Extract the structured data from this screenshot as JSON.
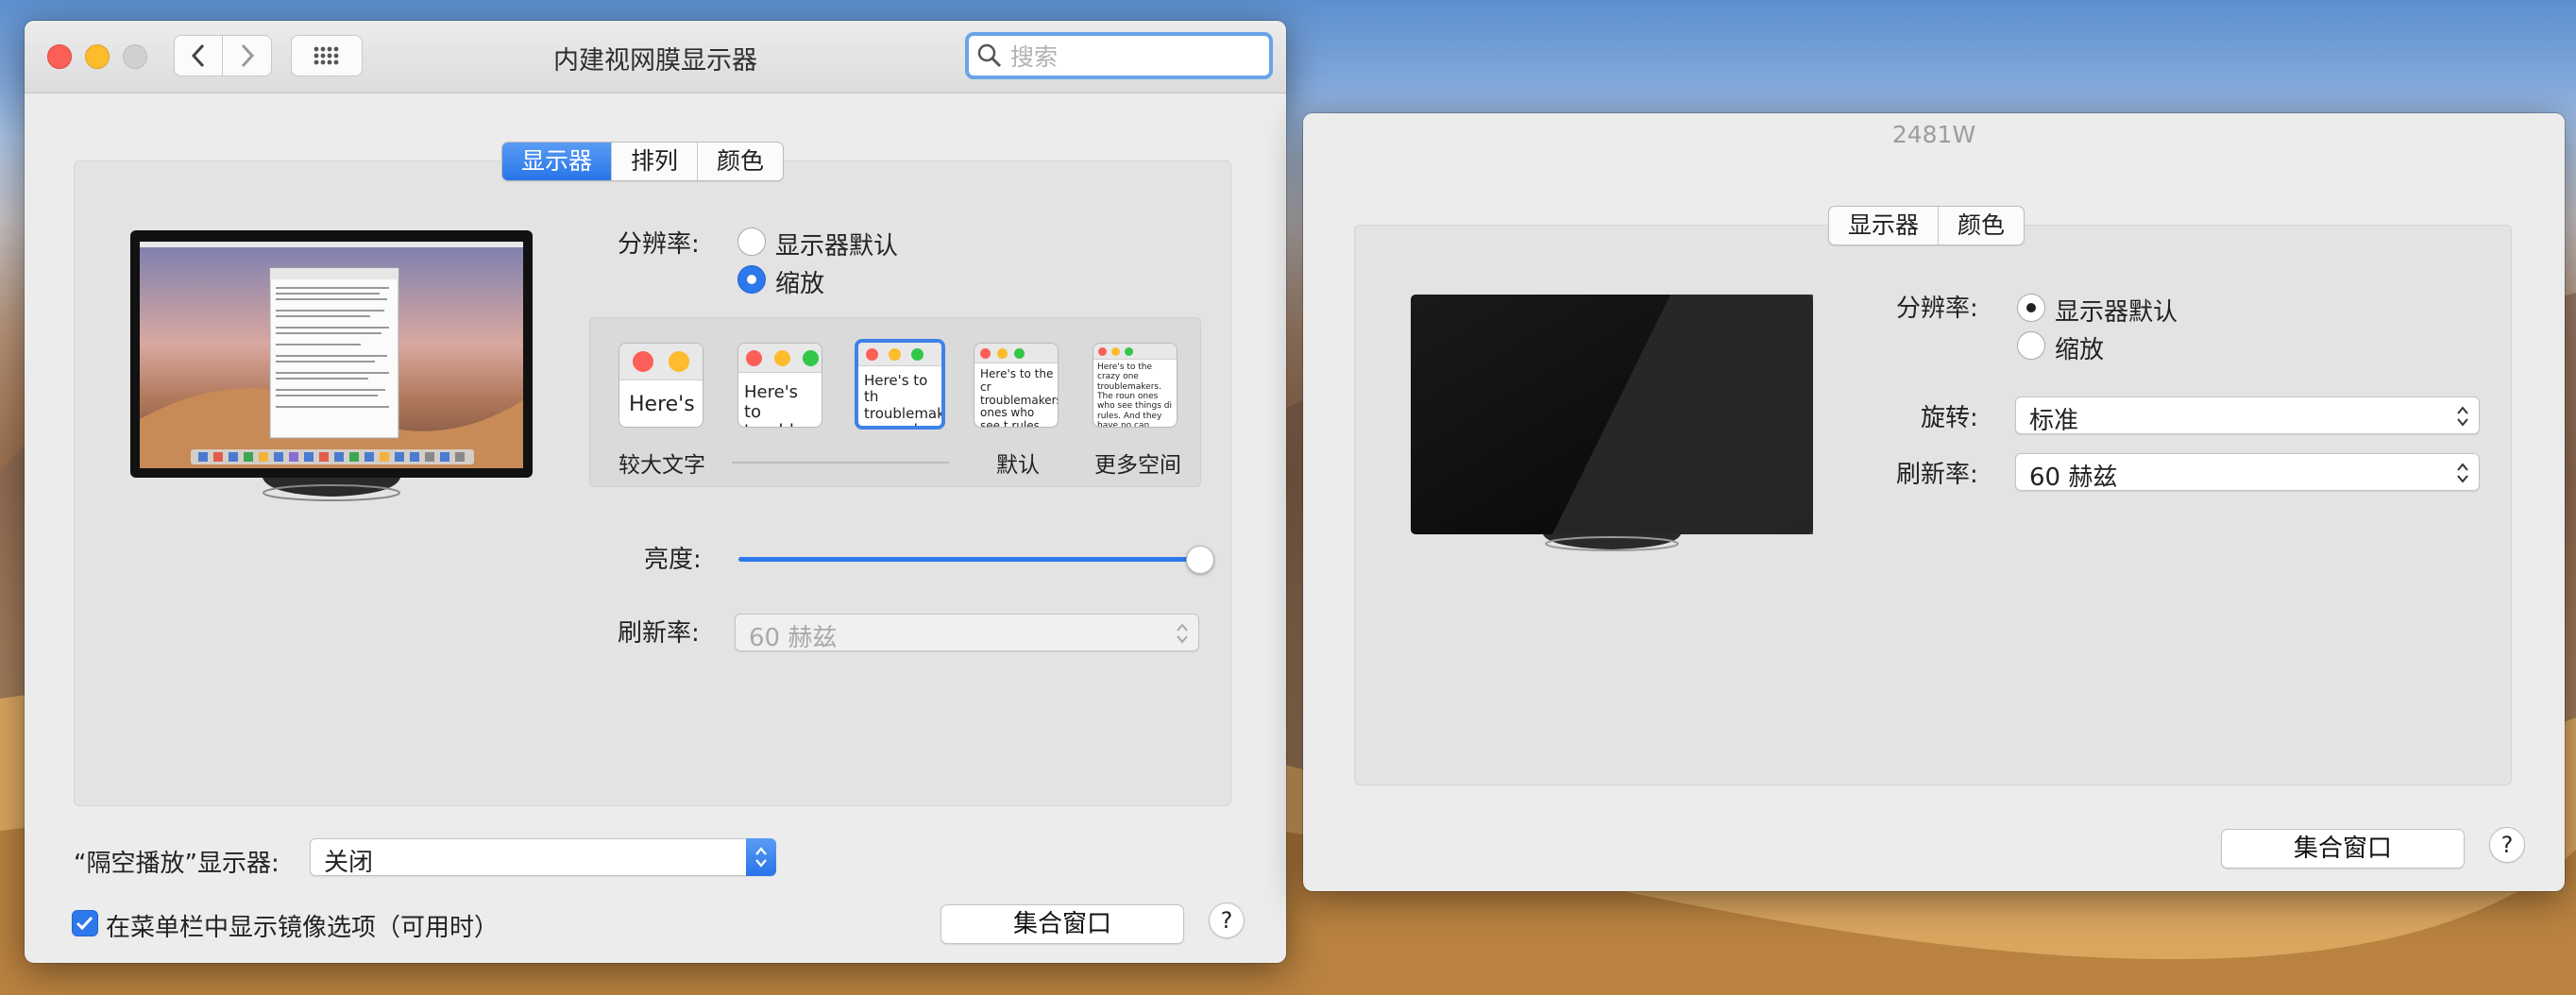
{
  "window1": {
    "title": "内建视网膜显示器",
    "search_placeholder": "搜索",
    "tabs": [
      {
        "label": "显示器",
        "selected": true
      },
      {
        "label": "排列",
        "selected": false
      },
      {
        "label": "颜色",
        "selected": false
      }
    ],
    "resolution": {
      "label": "分辨率:",
      "options": [
        {
          "label": "显示器默认",
          "selected": false
        },
        {
          "label": "缩放",
          "selected": true
        }
      ]
    },
    "scale_options": [
      {
        "sample": "Here's",
        "caption": "较大文字",
        "selected": false
      },
      {
        "sample": "Here's to troublem",
        "caption": "",
        "selected": false
      },
      {
        "sample": "Here's to th troublemak ones who",
        "caption": "",
        "selected": true
      },
      {
        "sample": "Here's to the cr troublemakers. ones who see t rules. And they",
        "caption": "默认",
        "selected": false
      },
      {
        "sample": "Here's to the crazy one troublemakers. The roun ones who see things di rules. And they have no can quote them, disagre them. About the only th Because they change th",
        "caption": "更多空间",
        "selected": false
      }
    ],
    "brightness": {
      "label": "亮度:",
      "value": 1.0
    },
    "refresh_rate": {
      "label": "刷新率:",
      "value": "60 赫兹"
    },
    "airplay": {
      "label": "“隔空播放”显示器:",
      "value": "关闭"
    },
    "mirroring_checkbox": {
      "label": "在菜单栏中显示镜像选项（可用时）",
      "checked": true
    },
    "gather_button": "集合窗口",
    "help": "?"
  },
  "window2": {
    "title": "2481W",
    "tabs": [
      {
        "label": "显示器",
        "selected": true
      },
      {
        "label": "颜色",
        "selected": false
      }
    ],
    "resolution": {
      "label": "分辨率:",
      "options": [
        {
          "label": "显示器默认",
          "selected": true
        },
        {
          "label": "缩放",
          "selected": false
        }
      ]
    },
    "rotation": {
      "label": "旋转:",
      "value": "标准"
    },
    "refresh_rate": {
      "label": "刷新率:",
      "value": "60 赫兹"
    },
    "gather_button": "集合窗口",
    "help": "?"
  },
  "colors": {
    "accent": "#2d78eb",
    "close": "#fc5f57",
    "minimize": "#fdbc2e"
  }
}
